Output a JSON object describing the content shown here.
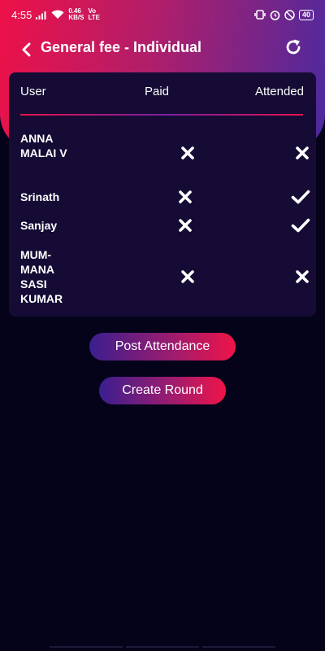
{
  "status_bar": {
    "time": "4:55",
    "net_speed_value": "0.46",
    "net_speed_unit": "KB/S",
    "volte": "Vo",
    "lte": "LTE",
    "battery": "40"
  },
  "header": {
    "title": "General fee - Individual",
    "back_icon": "chevron-left-icon",
    "refresh_icon": "refresh-icon"
  },
  "table": {
    "columns": [
      "User",
      "Paid",
      "Attended"
    ],
    "rows": [
      {
        "user": "ANNA MALAI V",
        "paid": false,
        "attended": false
      },
      {
        "user": "Srinath",
        "paid": false,
        "attended": true
      },
      {
        "user": "Sanjay",
        "paid": false,
        "attended": true
      },
      {
        "user": "MUM-MANA SASI KUMAR",
        "paid": false,
        "attended": false
      }
    ]
  },
  "actions": {
    "post_attendance": "Post Attendance",
    "create_round": "Create Round"
  },
  "colors": {
    "background": "#04031a",
    "card": "#150b35",
    "accent_red": "#ee1148",
    "accent_purple": "#4a2aa0"
  }
}
